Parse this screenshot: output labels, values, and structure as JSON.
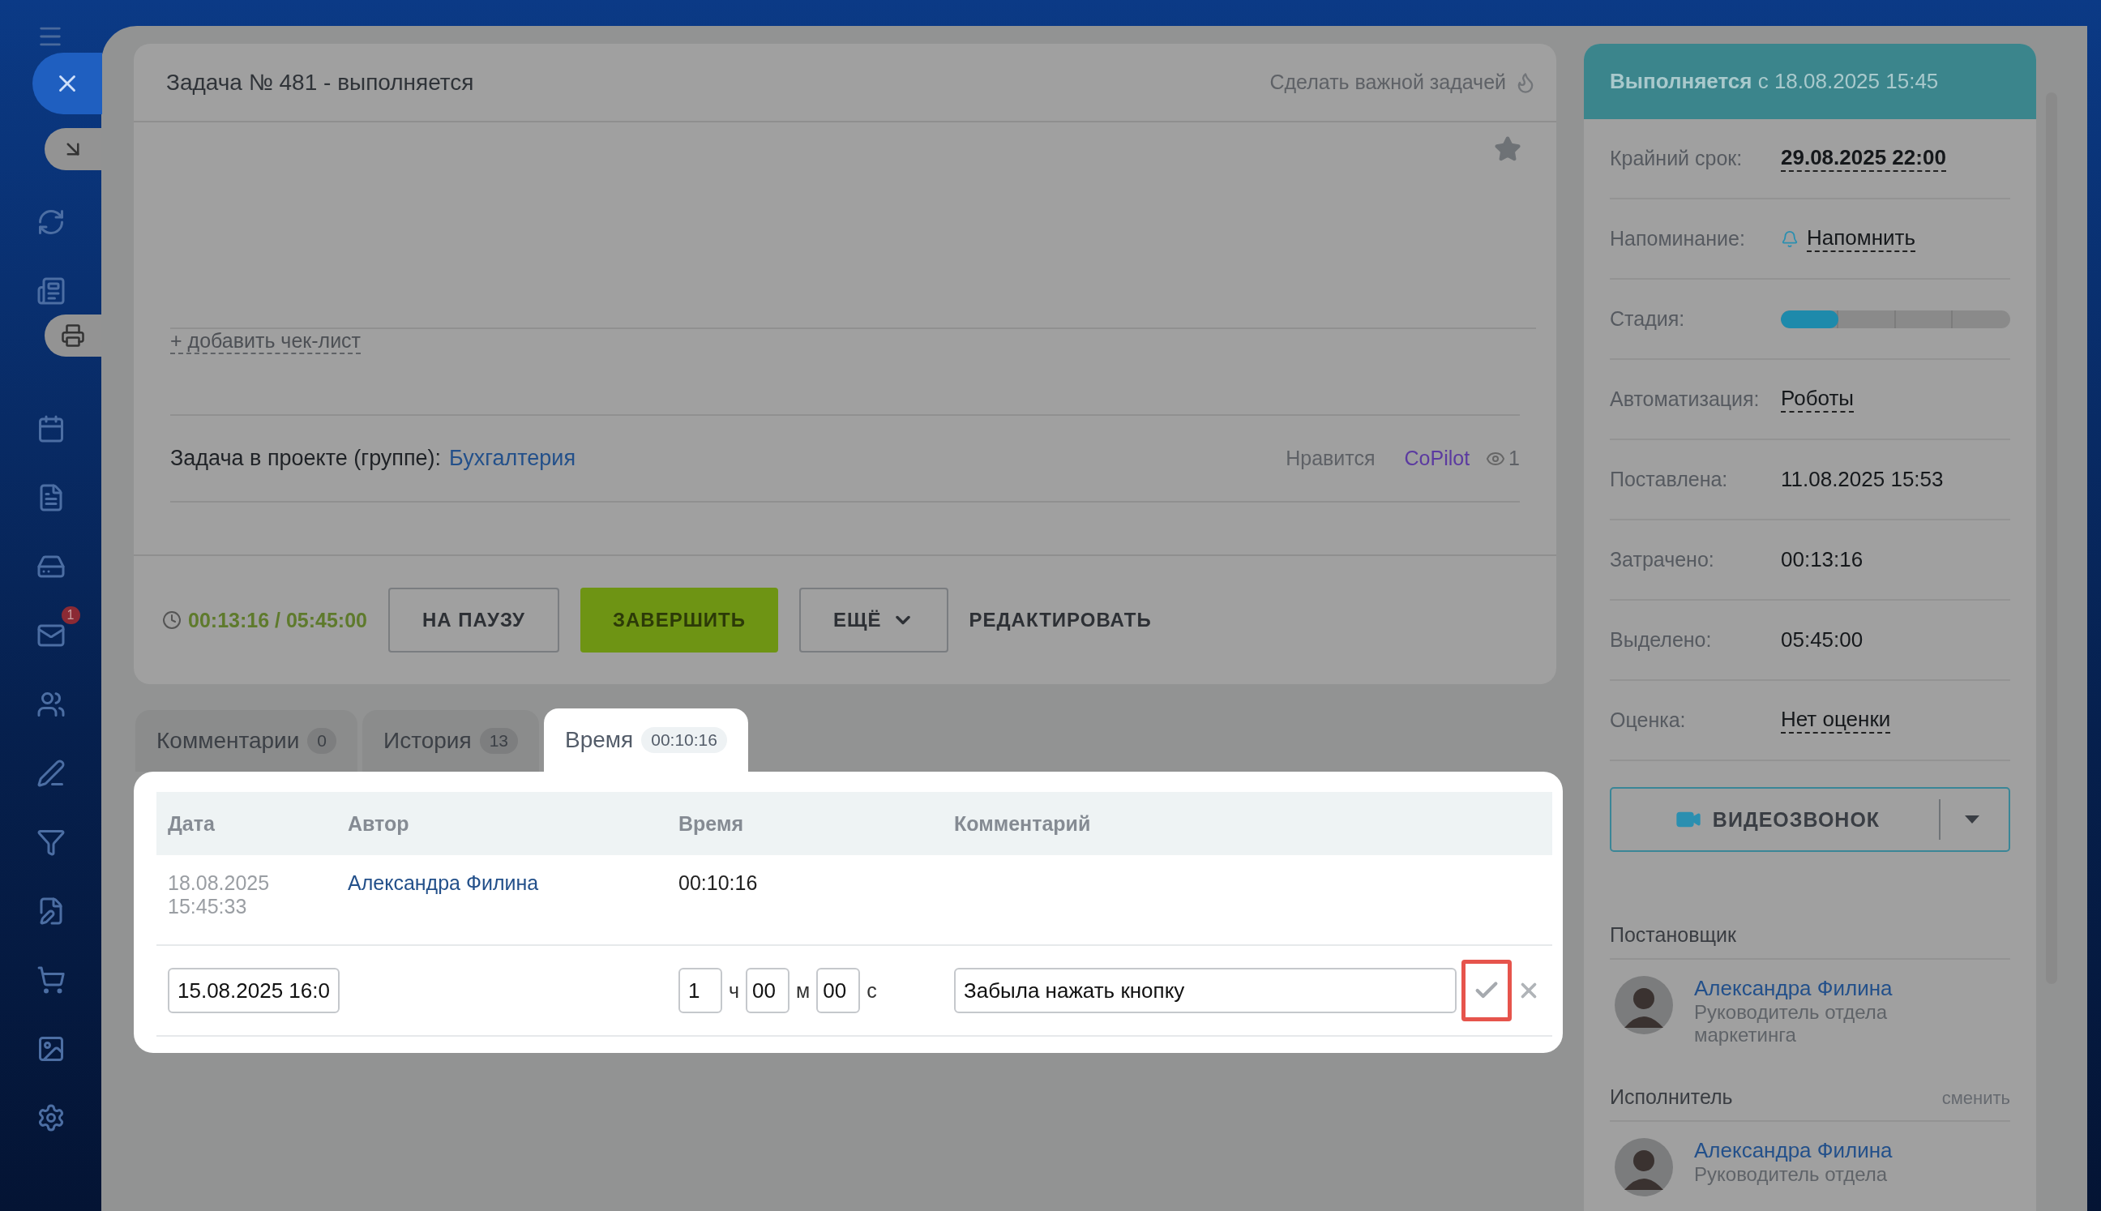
{
  "sidebar": {
    "mail_badge": "1"
  },
  "task": {
    "title": "Задача № 481 - выполняется",
    "important_label": "Сделать важной задачей",
    "checklist_link": "+ добавить чек-лист",
    "project_label": "Задача в проекте (группе):",
    "project_name": "Бухгалтерия",
    "likes_label": "Нравится",
    "copilot": "CoPilot",
    "views": "1",
    "timer": "00:13:16 / 05:45:00",
    "buttons": [
      {
        "label": "НА ПАУЗУ",
        "kind": "outline"
      },
      {
        "label": "ЗАВЕРШИТЬ",
        "kind": "primary"
      },
      {
        "label": "ЕЩЁ",
        "kind": "menu"
      },
      {
        "label": "РЕДАКТИРОВАТЬ",
        "kind": "link"
      }
    ]
  },
  "tabs": [
    {
      "label": "Комментарии",
      "count": "0",
      "selected": false
    },
    {
      "label": "История",
      "count": "13",
      "selected": false
    },
    {
      "label": "Время",
      "count": "00:10:16",
      "selected": true
    }
  ],
  "time_table": {
    "columns": [
      "Дата",
      "Автор",
      "Время",
      "Комментарий"
    ],
    "rows": [
      {
        "date": "18.08.2025",
        "time": "15:45:33",
        "author": "Александра Филина",
        "duration": "00:10:16"
      }
    ],
    "edit_row": {
      "date_value": "15.08.2025 16:0",
      "hours": "1",
      "hours_unit": "ч",
      "minutes": "00",
      "minutes_unit": "м",
      "seconds": "00",
      "seconds_unit": "с",
      "comment": "Забыла нажать кнопку"
    }
  },
  "side": {
    "status": "**Выполняется** с 18.08.2025 15:45",
    "fields": [
      {
        "label": "Крайний срок:",
        "value": "29.08.2025 22:00",
        "kind": "deadline"
      },
      {
        "label": "Напоминание:",
        "value": "Напомнить",
        "kind": "reminder"
      },
      {
        "label": "Стадия:",
        "kind": "stage",
        "level": 0.25
      },
      {
        "label": "Автоматизация:",
        "value": "Роботы",
        "kind": "link"
      },
      {
        "label": "Поставлена:",
        "value": "11.08.2025 15:53",
        "kind": "text"
      },
      {
        "label": "Затрачено:",
        "value": "00:13:16",
        "kind": "text"
      },
      {
        "label": "Выделено:",
        "value": "05:45:00",
        "kind": "text"
      },
      {
        "label": "Оценка:",
        "value": "Нет оценки",
        "kind": "link"
      }
    ],
    "video_button": "ВИДЕОЗВОНОК",
    "people": [
      {
        "title": "Постановщик",
        "name": "Александра Филина",
        "role": "Руководитель отдела маркетинга"
      },
      {
        "title": "Исполнитель",
        "action": "сменить",
        "name": "Александра Филина",
        "role": "Руководитель отдела"
      }
    ]
  }
}
